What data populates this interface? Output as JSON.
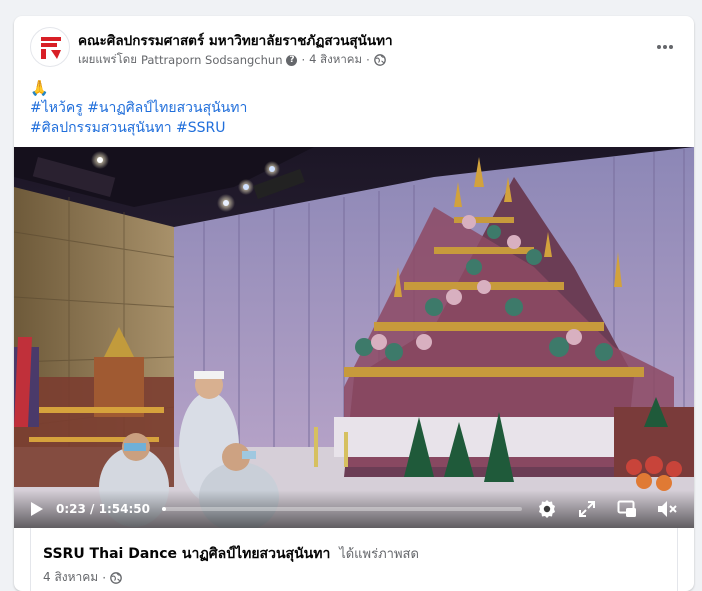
{
  "post": {
    "page_name": "คณะศิลปกรรมศาสตร์ มหาวิทยาลัยราชภัฏสวนสุนันทา",
    "published_by_label": "เผยแพร่โดย",
    "publisher": "Pattraporn Sodsangchun",
    "date": "4 สิงหาคม",
    "separator": "·",
    "more_icon": "more-horizontal-icon",
    "caption": {
      "emoji": "🙏",
      "hashtags_line1": [
        "#ไหว้ครู",
        "#นาฏศิลป์ไทยสวนสุนันทา"
      ],
      "hashtags_line2": [
        "#ศิลปกรรมสวนสุนันทา",
        "#SSRU"
      ]
    }
  },
  "video": {
    "current_time": "0:23",
    "time_separator": "/",
    "duration": "1:54:50",
    "progress": 0.003,
    "icons": [
      "play-icon",
      "settings-icon",
      "fullscreen-icon",
      "picture-in-picture-icon",
      "volume-muted-icon"
    ]
  },
  "live": {
    "title": "SSRU Thai Dance นาฏศิลป์ไทยสวนสุนันทา",
    "status": "ได้แพร่ภาพสด",
    "date": "4 สิงหาคม"
  },
  "colors": {
    "link": "#216fdb",
    "secondary_text": "#65676b",
    "brand_red": "#d81f26"
  }
}
